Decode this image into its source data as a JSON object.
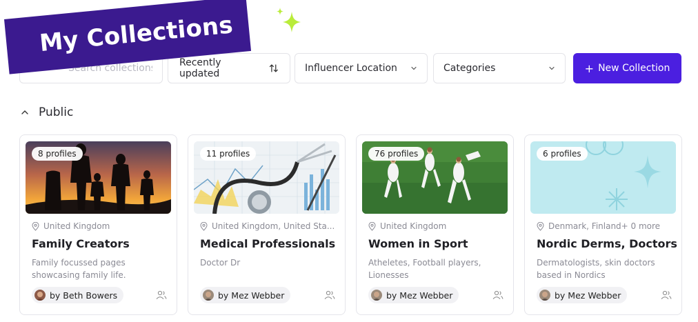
{
  "banner": {
    "title": "My Collections"
  },
  "toolbar": {
    "search_placeholder": "Search collections",
    "sort_label": "Recently updated",
    "location_filter_label": "Influencer Location",
    "categories_filter_label": "Categories",
    "new_collection_label": "New Collection"
  },
  "section": {
    "label": "Public"
  },
  "colors": {
    "accent": "#4b1fe0",
    "banner": "#3b1a8f",
    "sparkle": "#b9ec3a"
  },
  "cards": [
    {
      "badge": "8 profiles",
      "location": "United Kingdom",
      "title": "Family Creators",
      "description": "Family focussed pages showcasing family life.",
      "author": "by Beth Bowers",
      "image": "family-silhouette-sunset"
    },
    {
      "badge": "11 profiles",
      "location": "United Kingdom, United Sta...",
      "title": "Medical Professionals",
      "description": "Doctor Dr",
      "author": "by Mez Webber",
      "image": "stethoscope-charts"
    },
    {
      "badge": "76 profiles",
      "location": "United Kingdom",
      "title": "Women in Sport",
      "description": "Atheletes, Football players, Lionesses",
      "author": "by Mez Webber",
      "image": "football-players"
    },
    {
      "badge": "6 profiles",
      "location": "Denmark, Finland+ 0 more",
      "title": "Nordic Derms, Doctors...",
      "description": "Dermatologists, skin doctors based in Nordics",
      "author": "by Mez Webber",
      "image": "light-blue-pattern"
    }
  ]
}
